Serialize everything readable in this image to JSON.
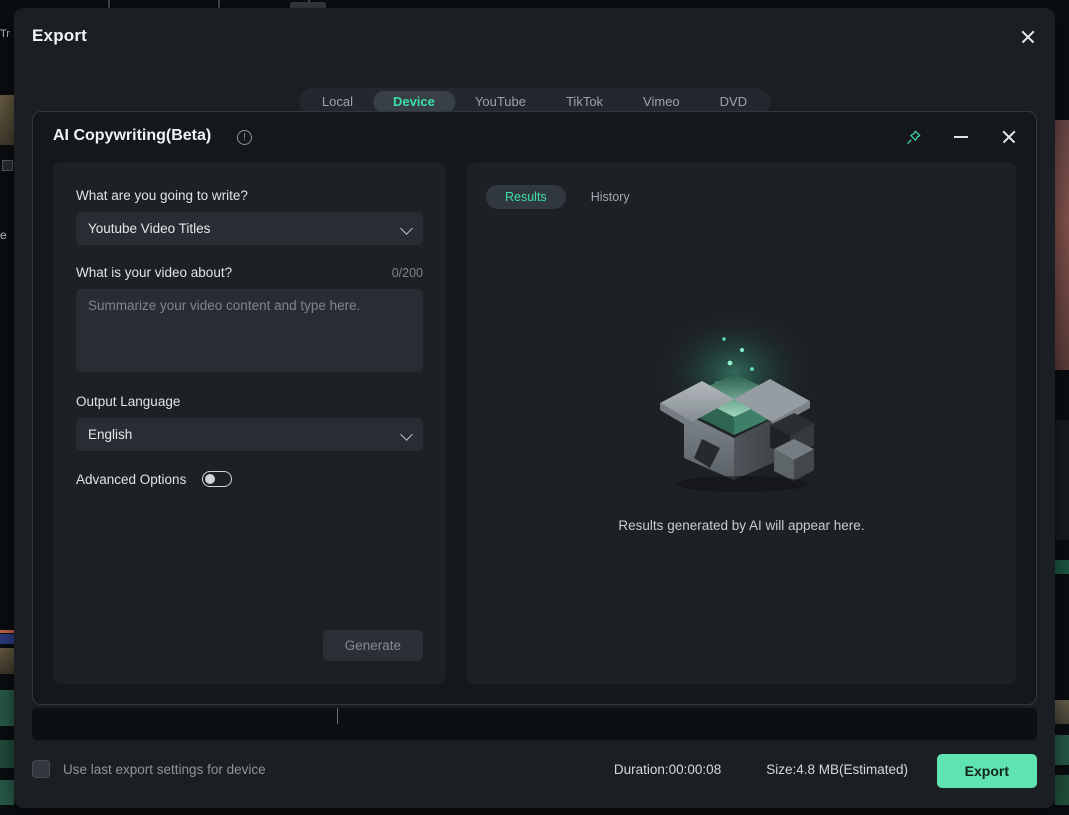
{
  "export_dialog": {
    "title": "Export",
    "close_icon": "close-icon",
    "tabs": [
      {
        "label": "Local",
        "active": false
      },
      {
        "label": "Device",
        "active": true
      },
      {
        "label": "YouTube",
        "active": false
      },
      {
        "label": "TikTok",
        "active": false
      },
      {
        "label": "Vimeo",
        "active": false
      },
      {
        "label": "DVD",
        "active": false
      }
    ],
    "footer": {
      "checkbox_label": "Use last export settings for device",
      "checkbox_checked": false,
      "duration": "Duration:00:00:08",
      "size": "Size:4.8 MB(Estimated)",
      "export_button": "Export"
    }
  },
  "ai_panel": {
    "title": "AI Copywriting(Beta)",
    "info_icon": "info-icon",
    "info_glyph": "!",
    "pin_icon": "pin-icon",
    "minimize_icon": "minimize-icon",
    "close_icon": "close-icon",
    "form": {
      "write_label": "What are you going to write?",
      "write_value": "Youtube Video Titles",
      "about_label": "What is your video about?",
      "about_counter": "0/200",
      "about_value": "",
      "about_placeholder": "Summarize your video content and type here.",
      "language_label": "Output Language",
      "language_value": "English",
      "advanced_label": "Advanced Options",
      "advanced_enabled": false,
      "generate_button": "Generate"
    },
    "results": {
      "tabs": [
        {
          "label": "Results",
          "active": true
        },
        {
          "label": "History",
          "active": false
        }
      ],
      "empty_text": "Results generated by AI will appear here.",
      "empty_illustration": "open-box-illustration"
    }
  },
  "colors": {
    "accent_green": "#3ddfa8",
    "export_button": "#5fe3b0",
    "dialog_bg": "#1b1f24",
    "panel_bg": "#14171b",
    "card_bg": "#1d2126",
    "input_bg": "#282d33"
  }
}
